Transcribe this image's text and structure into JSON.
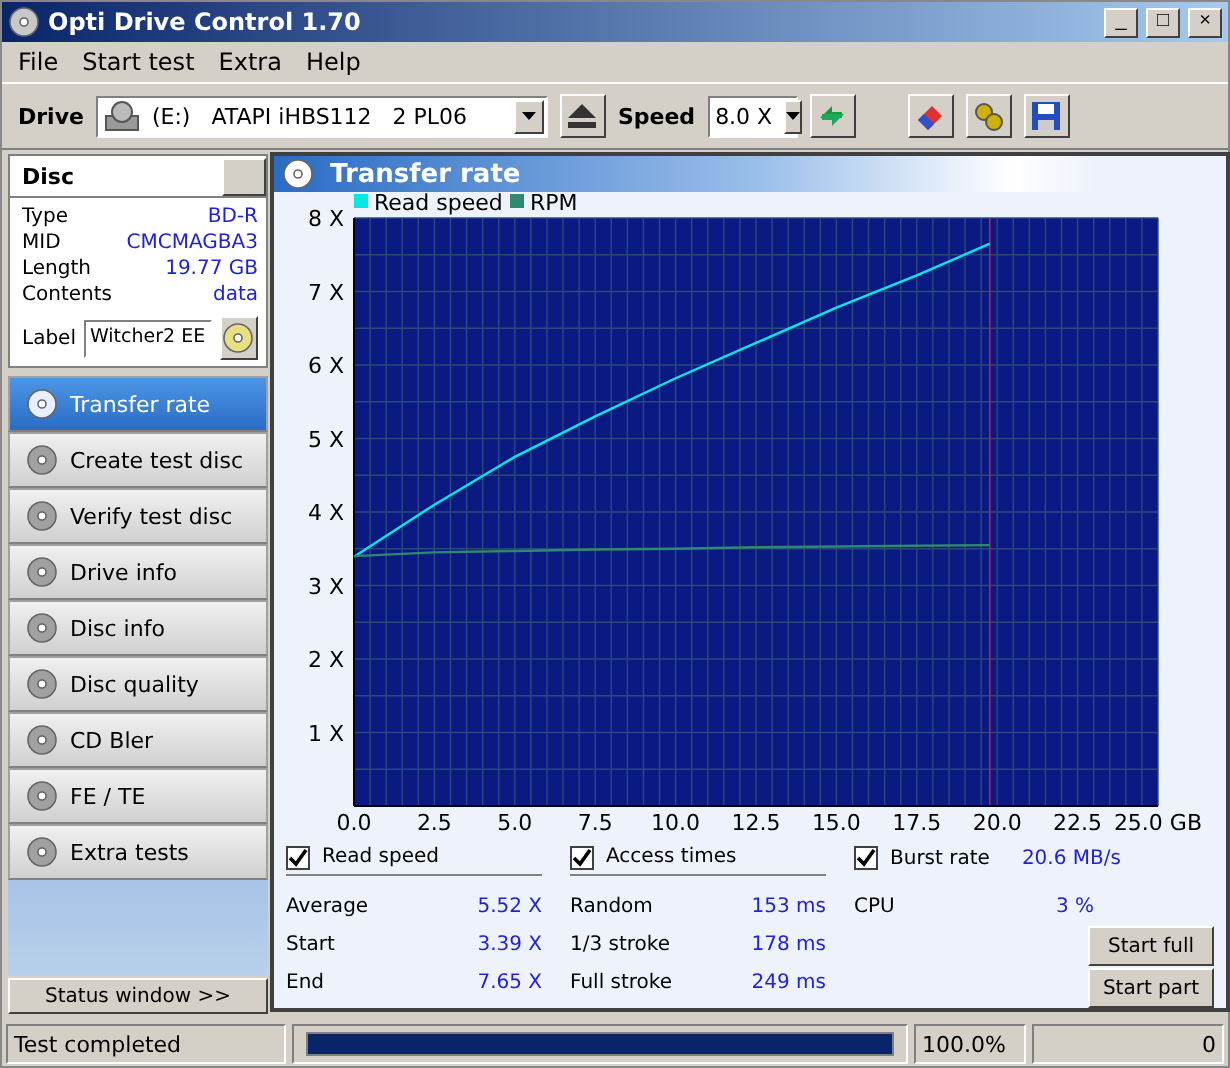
{
  "window": {
    "title": "Opti Drive Control 1.70",
    "controls": [
      "_",
      "□",
      "×"
    ]
  },
  "menu": [
    "File",
    "Start test",
    "Extra",
    "Help"
  ],
  "toolbar": {
    "drive_label": "Drive",
    "drive": "(E:)   ATAPI iHBS112   2 PL06",
    "speed_label": "Speed",
    "speed": "8.0 X"
  },
  "disc": {
    "title": "Disc",
    "fields": [
      {
        "label": "Type",
        "value": "BD-R"
      },
      {
        "label": "MID",
        "value": "CMCMAGBA3"
      },
      {
        "label": "Length",
        "value": "19.77 GB"
      },
      {
        "label": "Contents",
        "value": "data"
      }
    ],
    "label_caption": "Label",
    "label_value": "Witcher2 EE"
  },
  "nav": [
    {
      "label": "Transfer rate",
      "selected": true
    },
    {
      "label": "Create test disc",
      "selected": false
    },
    {
      "label": "Verify test disc",
      "selected": false
    },
    {
      "label": "Drive info",
      "selected": false
    },
    {
      "label": "Disc info",
      "selected": false
    },
    {
      "label": "Disc quality",
      "selected": false
    },
    {
      "label": "CD Bler",
      "selected": false
    },
    {
      "label": "FE / TE",
      "selected": false
    },
    {
      "label": "Extra tests",
      "selected": false
    }
  ],
  "status_window_button": "Status window >>",
  "panel_title": "Transfer rate",
  "chart_data": {
    "type": "line",
    "grid": true,
    "legend": true,
    "ref_lines": [
      {
        "axis": "x",
        "value": 19.77,
        "color": "#c02040"
      }
    ],
    "x": [
      0,
      2.5,
      5,
      7.5,
      10,
      12.5,
      15,
      17.5,
      19.77
    ],
    "xlim": [
      0,
      25
    ],
    "ylim": [
      0,
      8
    ],
    "xticks": [
      {
        "value": 0,
        "label": "0.0"
      },
      {
        "value": 2.5,
        "label": "2.5"
      },
      {
        "value": 5,
        "label": "5.0"
      },
      {
        "value": 7.5,
        "label": "7.5"
      },
      {
        "value": 10,
        "label": "10.0"
      },
      {
        "value": 12.5,
        "label": "12.5"
      },
      {
        "value": 15,
        "label": "15.0"
      },
      {
        "value": 17.5,
        "label": "17.5"
      },
      {
        "value": 20,
        "label": "20.0"
      },
      {
        "value": 22.5,
        "label": "22.5"
      },
      {
        "value": 25,
        "label": "25.0 GB"
      }
    ],
    "yticks": [
      {
        "value": 1,
        "label": "1 X"
      },
      {
        "value": 2,
        "label": "2 X"
      },
      {
        "value": 3,
        "label": "3 X"
      },
      {
        "value": 4,
        "label": "4 X"
      },
      {
        "value": 5,
        "label": "5 X"
      },
      {
        "value": 6,
        "label": "6 X"
      },
      {
        "value": 7,
        "label": "7 X"
      },
      {
        "value": 8,
        "label": "8 X"
      }
    ],
    "series": [
      {
        "name": "Read speed",
        "color": "#00e8e8",
        "values": [
          3.39,
          4.1,
          4.75,
          5.3,
          5.82,
          6.3,
          6.78,
          7.22,
          7.65
        ]
      },
      {
        "name": "RPM",
        "color": "#2e8a6e",
        "values": [
          3.4,
          3.45,
          3.47,
          3.49,
          3.5,
          3.52,
          3.53,
          3.54,
          3.55
        ]
      }
    ]
  },
  "stats": {
    "read_speed": {
      "label": "Read speed",
      "checked": true,
      "rows": [
        {
          "label": "Average",
          "value": "5.52 X"
        },
        {
          "label": "Start",
          "value": "3.39 X"
        },
        {
          "label": "End",
          "value": "7.65 X"
        }
      ]
    },
    "access_times": {
      "label": "Access times",
      "checked": true,
      "rows": [
        {
          "label": "Random",
          "value": "153 ms"
        },
        {
          "label": "1/3 stroke",
          "value": "178 ms"
        },
        {
          "label": "Full stroke",
          "value": "249 ms"
        }
      ]
    },
    "burst_rate": {
      "label": "Burst rate",
      "checked": true,
      "value": "20.6 MB/s"
    },
    "cpu": {
      "label": "CPU",
      "value": "3 %"
    },
    "buttons": [
      "Start full",
      "Start part"
    ]
  },
  "status_bar": {
    "message": "Test completed",
    "progress": {
      "level": 1
    },
    "percent": "100.0%",
    "count": "0"
  }
}
